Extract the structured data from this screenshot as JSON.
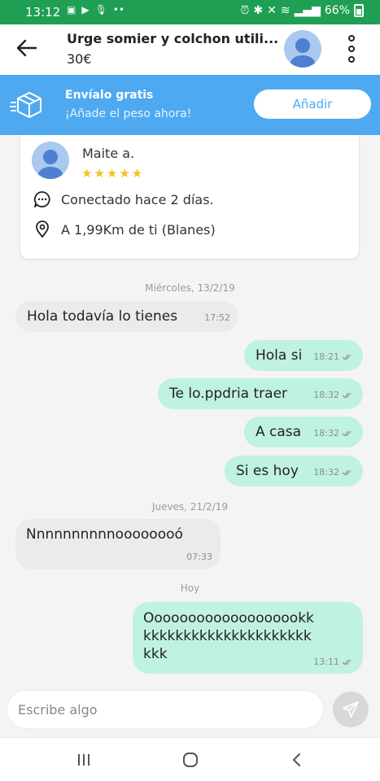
{
  "status_bar": {
    "time": "13:12",
    "battery": "66%"
  },
  "header": {
    "title": "Urge somier y colchon utili...",
    "price": "30€"
  },
  "shipping": {
    "title": "Envíalo gratis",
    "subtitle": "¡Añade el peso ahora!",
    "button": "Añadir"
  },
  "seller": {
    "name": "Maite a.",
    "rating_stars": 5,
    "connected": "Conectado hace 2 días.",
    "location": "A 1,99Km de ti (Blanes)"
  },
  "chat": {
    "date1": "Miércoles, 13/2/19",
    "date2": "Jueves, 21/2/19",
    "date3": "Hoy",
    "messages": [
      {
        "dir": "in",
        "text": "Hola todavía lo tienes",
        "time": "17:52"
      },
      {
        "dir": "out",
        "text": "Hola si",
        "time": "18:21"
      },
      {
        "dir": "out",
        "text": "Te lo.ppdria traer",
        "time": "18:32"
      },
      {
        "dir": "out",
        "text": "A casa",
        "time": "18:32"
      },
      {
        "dir": "out",
        "text": "Si es hoy",
        "time": "18:32"
      },
      {
        "dir": "in",
        "text": "Nnnnnnnnnnoooooooó",
        "time": "07:33"
      },
      {
        "dir": "out",
        "lines": [
          "Ooooooooooooooooookk",
          "kkkkkkkkkkkkkkkkkkkkk",
          "kkk"
        ],
        "time": "13:11"
      }
    ]
  },
  "input": {
    "placeholder": "Escribe algo"
  },
  "colors": {
    "status_bar": "#1f9f54",
    "banner": "#4ea9f0",
    "outgoing_bubble": "#bff2df",
    "incoming_bubble": "#ebebeb",
    "stars": "#f2c418"
  }
}
